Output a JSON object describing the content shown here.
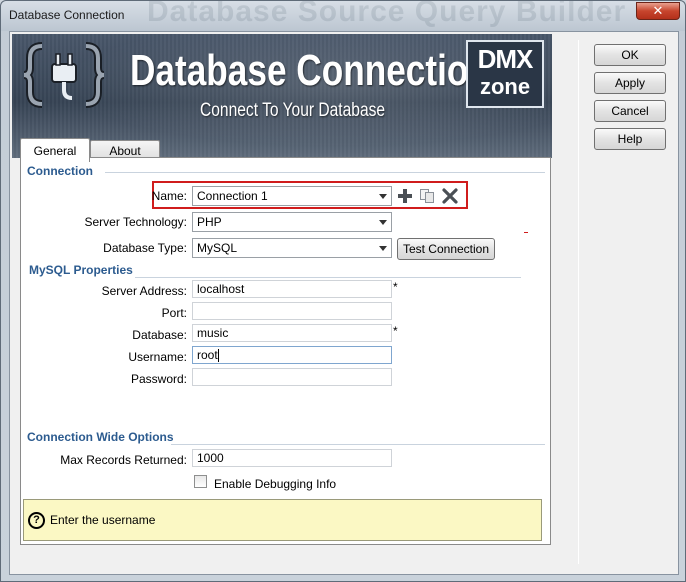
{
  "window": {
    "title": "Database Connection",
    "title_ghost": "Database Source Query Builder",
    "close_glyph": "✕"
  },
  "banner": {
    "title": "Database Connection",
    "subtitle": "Connect To Your Database",
    "brand_top": "DMX",
    "brand_bottom": "zone"
  },
  "tabs": [
    {
      "label": "General",
      "active": true
    },
    {
      "label": "About",
      "active": false
    }
  ],
  "connection": {
    "section_title": "Connection",
    "name_label": "Name:",
    "name_value": "Connection 1",
    "server_technology_label": "Server Technology:",
    "server_technology_value": "PHP",
    "database_type_label": "Database Type:",
    "database_type_value": "MySQL",
    "test_connection_label": "Test Connection",
    "toolbar_icons": [
      "add-icon",
      "duplicate-icon",
      "delete-icon"
    ]
  },
  "mysql": {
    "section_title": "MySQL Properties",
    "server_address_label": "Server Address:",
    "server_address_value": "localhost",
    "port_label": "Port:",
    "port_value": "",
    "database_label": "Database:",
    "database_value": "music",
    "username_label": "Username:",
    "username_value": "root",
    "password_label": "Password:",
    "password_value": "",
    "required_mark": "*"
  },
  "wide_options": {
    "section_title": "Connection Wide Options",
    "max_records_label": "Max Records Returned:",
    "max_records_value": "1000",
    "debug_label": "Enable Debugging Info",
    "debug_checked": false
  },
  "help": {
    "icon_glyph": "?",
    "text": "Enter the username"
  },
  "side_buttons": {
    "ok": "OK",
    "apply": "Apply",
    "cancel": "Cancel",
    "help": "Help"
  },
  "colors": {
    "section_title": "#2c5b8f",
    "highlight_border": "#d01c1c",
    "help_background": "#fbf8c4"
  }
}
